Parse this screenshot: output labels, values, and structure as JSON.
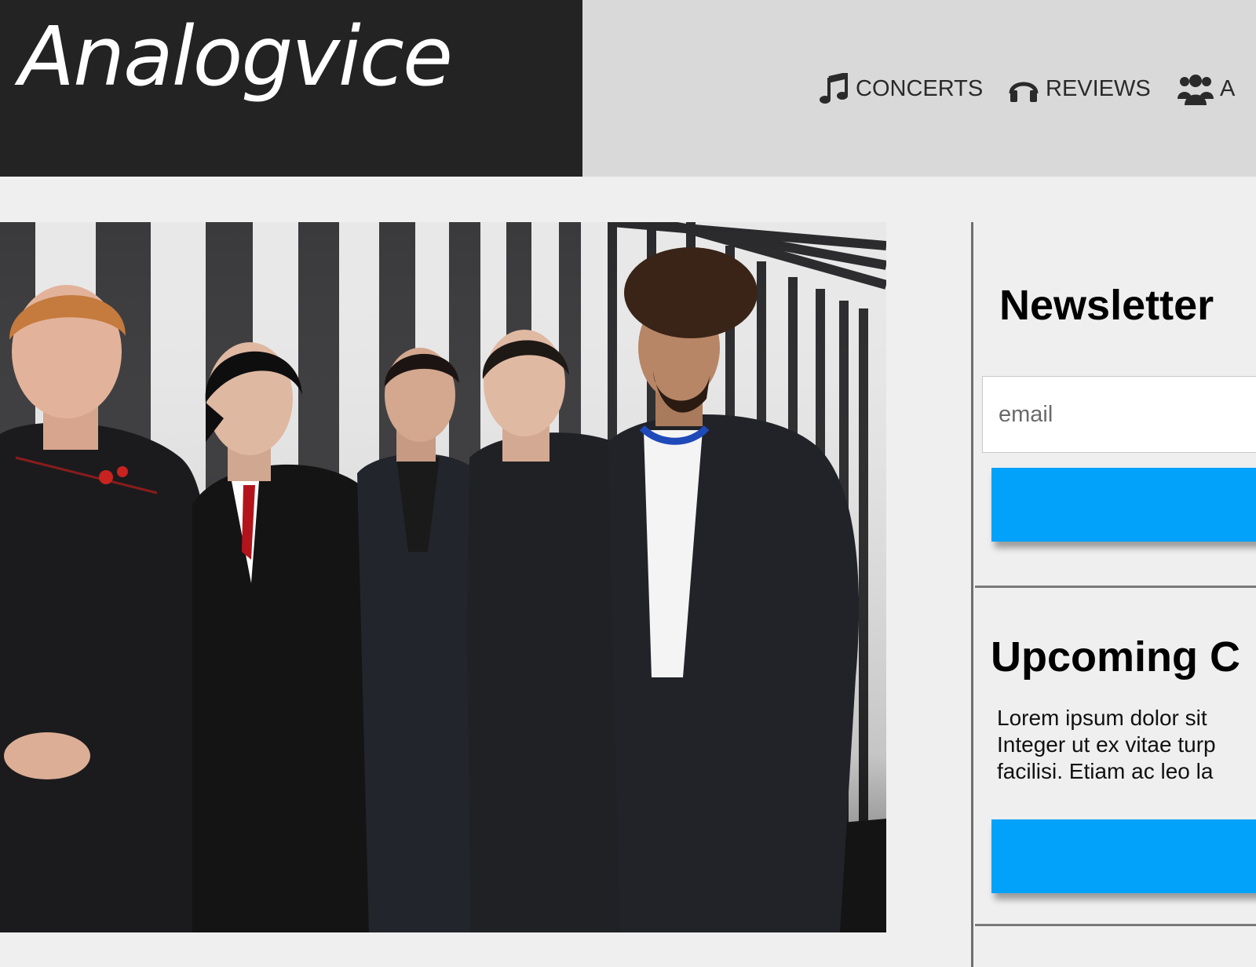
{
  "brand": {
    "logo_text": "Analogvice"
  },
  "nav": {
    "items": [
      {
        "label": "CONCERTS",
        "icon": "music-note-icon"
      },
      {
        "label": "REVIEWS",
        "icon": "headphones-icon"
      },
      {
        "label": "A",
        "icon": "users-icon"
      }
    ]
  },
  "sidebar": {
    "newsletter": {
      "title": "Newsletter",
      "email_placeholder": "email"
    },
    "upcoming": {
      "title": "Upcoming C",
      "lines": [
        "Lorem ipsum dolor sit",
        "Integer ut ex vitae turp",
        "facilisi. Etiam ac leo la"
      ]
    }
  },
  "colors": {
    "header_dark": "#232323",
    "nav_bg": "#d9d9d9",
    "page_bg": "#efefef",
    "accent_blue": "#02a1fa"
  }
}
